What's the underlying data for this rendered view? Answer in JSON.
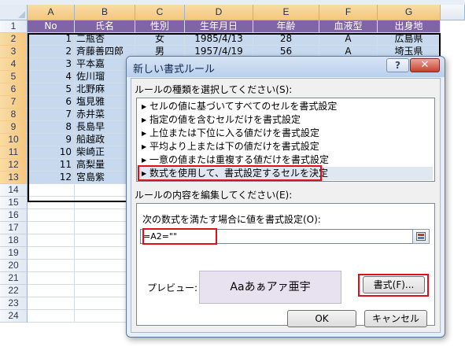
{
  "sheet": {
    "columns": [
      "A",
      "B",
      "C",
      "D",
      "E",
      "F",
      "G"
    ],
    "rows": [
      "1",
      "2",
      "3",
      "4",
      "5",
      "6",
      "7",
      "8",
      "9",
      "10",
      "11",
      "12",
      "13",
      "14",
      "15",
      "16",
      "17",
      "18",
      "19",
      "20",
      "21",
      "22",
      "23",
      "24"
    ],
    "header_row": [
      "No",
      "氏名",
      "性別",
      "生年月日",
      "年齢",
      "血液型",
      "出身地"
    ],
    "data_rows": [
      [
        "1",
        "二瓶杏",
        "女",
        "1985/4/13",
        "28",
        "A",
        "広島県"
      ],
      [
        "2",
        "斉藤善四郎",
        "男",
        "1957/4/19",
        "56",
        "A",
        "埼玉県"
      ],
      [
        "3",
        "平本嘉",
        "",
        "",
        "",
        "",
        ""
      ],
      [
        "4",
        "佐川瑠",
        "",
        "",
        "",
        "",
        ""
      ],
      [
        "5",
        "北野麻",
        "",
        "",
        "",
        "",
        ""
      ],
      [
        "6",
        "塩見雅",
        "",
        "",
        "",
        "",
        ""
      ],
      [
        "7",
        "赤井菜",
        "",
        "",
        "",
        "",
        ""
      ],
      [
        "8",
        "長島早",
        "",
        "",
        "",
        "",
        ""
      ],
      [
        "9",
        "船越政",
        "",
        "",
        "",
        "",
        ""
      ],
      [
        "10",
        "柴崎正",
        "",
        "",
        "",
        "",
        ""
      ],
      [
        "11",
        "高梨量",
        "",
        "",
        "",
        "",
        ""
      ],
      [
        "12",
        "宮島紫",
        "",
        "",
        "",
        "",
        ""
      ]
    ]
  },
  "dialog": {
    "title": "新しい書式ルール",
    "help_label": "?",
    "close_label": "✕",
    "rule_type_label": "ルールの種類を選択してください(S):",
    "rule_types": [
      "セルの値に基づいてすべてのセルを書式設定",
      "指定の値を含むセルだけを書式設定",
      "上位または下位に入る値だけを書式設定",
      "平均より上または下の値だけを書式設定",
      "一意の値または重複する値だけを書式設定",
      "数式を使用して、書式設定するセルを決定"
    ],
    "selected_rule_index": 5,
    "edit_label": "ルールの内容を編集してください(E):",
    "formula_label": "次の数式を満たす場合に値を書式設定(O):",
    "formula_value": "=A2=\"\"",
    "preview_label": "プレビュー:",
    "preview_text": "Aaあぁアァ亜宇",
    "format_button": "書式(F)...",
    "ok_button": "OK",
    "cancel_button": "キャンセル"
  },
  "colors": {
    "header_fill": "#7f64a6",
    "selection_fill": "#c6d9ef",
    "preview_fill": "#e8e2f0",
    "highlight_border": "#e0101a"
  }
}
